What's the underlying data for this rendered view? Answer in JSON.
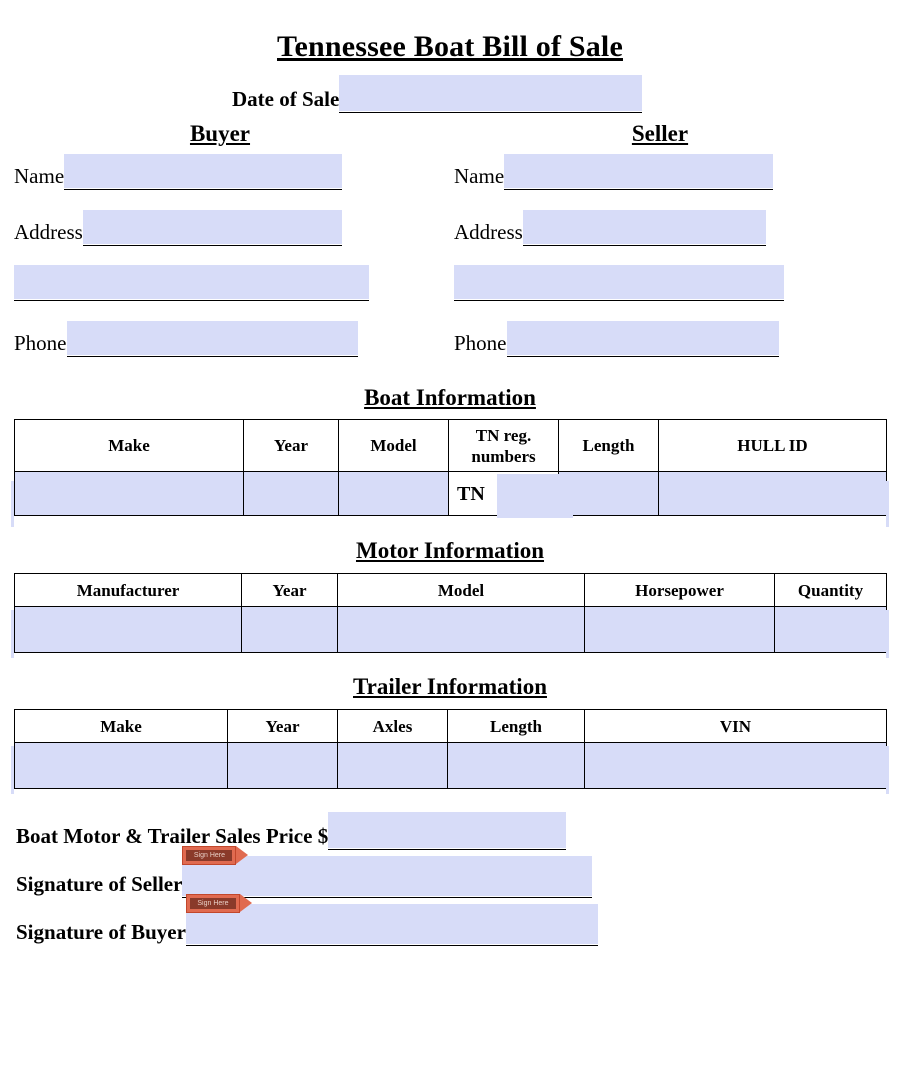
{
  "title": "Tennessee Boat Bill of Sale",
  "date_of_sale": {
    "label": "Date of Sale",
    "value": ""
  },
  "parties": {
    "buyer": {
      "heading": "Buyer",
      "name_label": "Name",
      "address_label": "Address",
      "phone_label": "Phone",
      "name_value": "",
      "address_value": "",
      "address2_value": "",
      "phone_value": ""
    },
    "seller": {
      "heading": "Seller",
      "name_label": "Name",
      "address_label": "Address",
      "phone_label": "Phone",
      "name_value": "",
      "address_value": "",
      "address2_value": "",
      "phone_value": ""
    }
  },
  "boat": {
    "heading": "Boat Information",
    "columns": [
      "Make",
      "Year",
      "Model",
      "TN reg.\nnumbers",
      "Length",
      "HULL ID"
    ],
    "col_make": "Make",
    "col_year": "Year",
    "col_model": "Model",
    "col_reg_line1": "TN reg.",
    "col_reg_line2": "numbers",
    "col_length": "Length",
    "col_hull": "HULL ID",
    "tn_prefix": "TN",
    "values": {
      "make": "",
      "year": "",
      "model": "",
      "reg": "",
      "length": "",
      "hull": ""
    }
  },
  "motor": {
    "heading": "Motor Information",
    "columns": [
      "Manufacturer",
      "Year",
      "Model",
      "Horsepower",
      "Quantity"
    ],
    "col_manufacturer": "Manufacturer",
    "col_year": "Year",
    "col_model": "Model",
    "col_horsepower": "Horsepower",
    "col_quantity": "Quantity",
    "values": {
      "manufacturer": "",
      "year": "",
      "model": "",
      "horsepower": "",
      "quantity": ""
    }
  },
  "trailer": {
    "heading": "Trailer Information",
    "columns": [
      "Make",
      "Year",
      "Axles",
      "Length",
      "VIN"
    ],
    "col_make": "Make",
    "col_year": "Year",
    "col_axles": "Axles",
    "col_length": "Length",
    "col_vin": "VIN",
    "values": {
      "make": "",
      "year": "",
      "axles": "",
      "length": "",
      "vin": ""
    }
  },
  "bottom": {
    "price_label": "Boat Motor & Trailer Sales Price $",
    "price_value": "",
    "signature_seller_label": "Signature of Seller",
    "signature_seller_value": "",
    "signature_buyer_label": "Signature of Buyer",
    "signature_buyer_value": "",
    "sign_tag_text": "Sign Here"
  },
  "colors": {
    "field_fill": "#d7dcf8",
    "border": "#000000",
    "sign_tag": "#e06a50",
    "page_background": "#ffffff"
  }
}
